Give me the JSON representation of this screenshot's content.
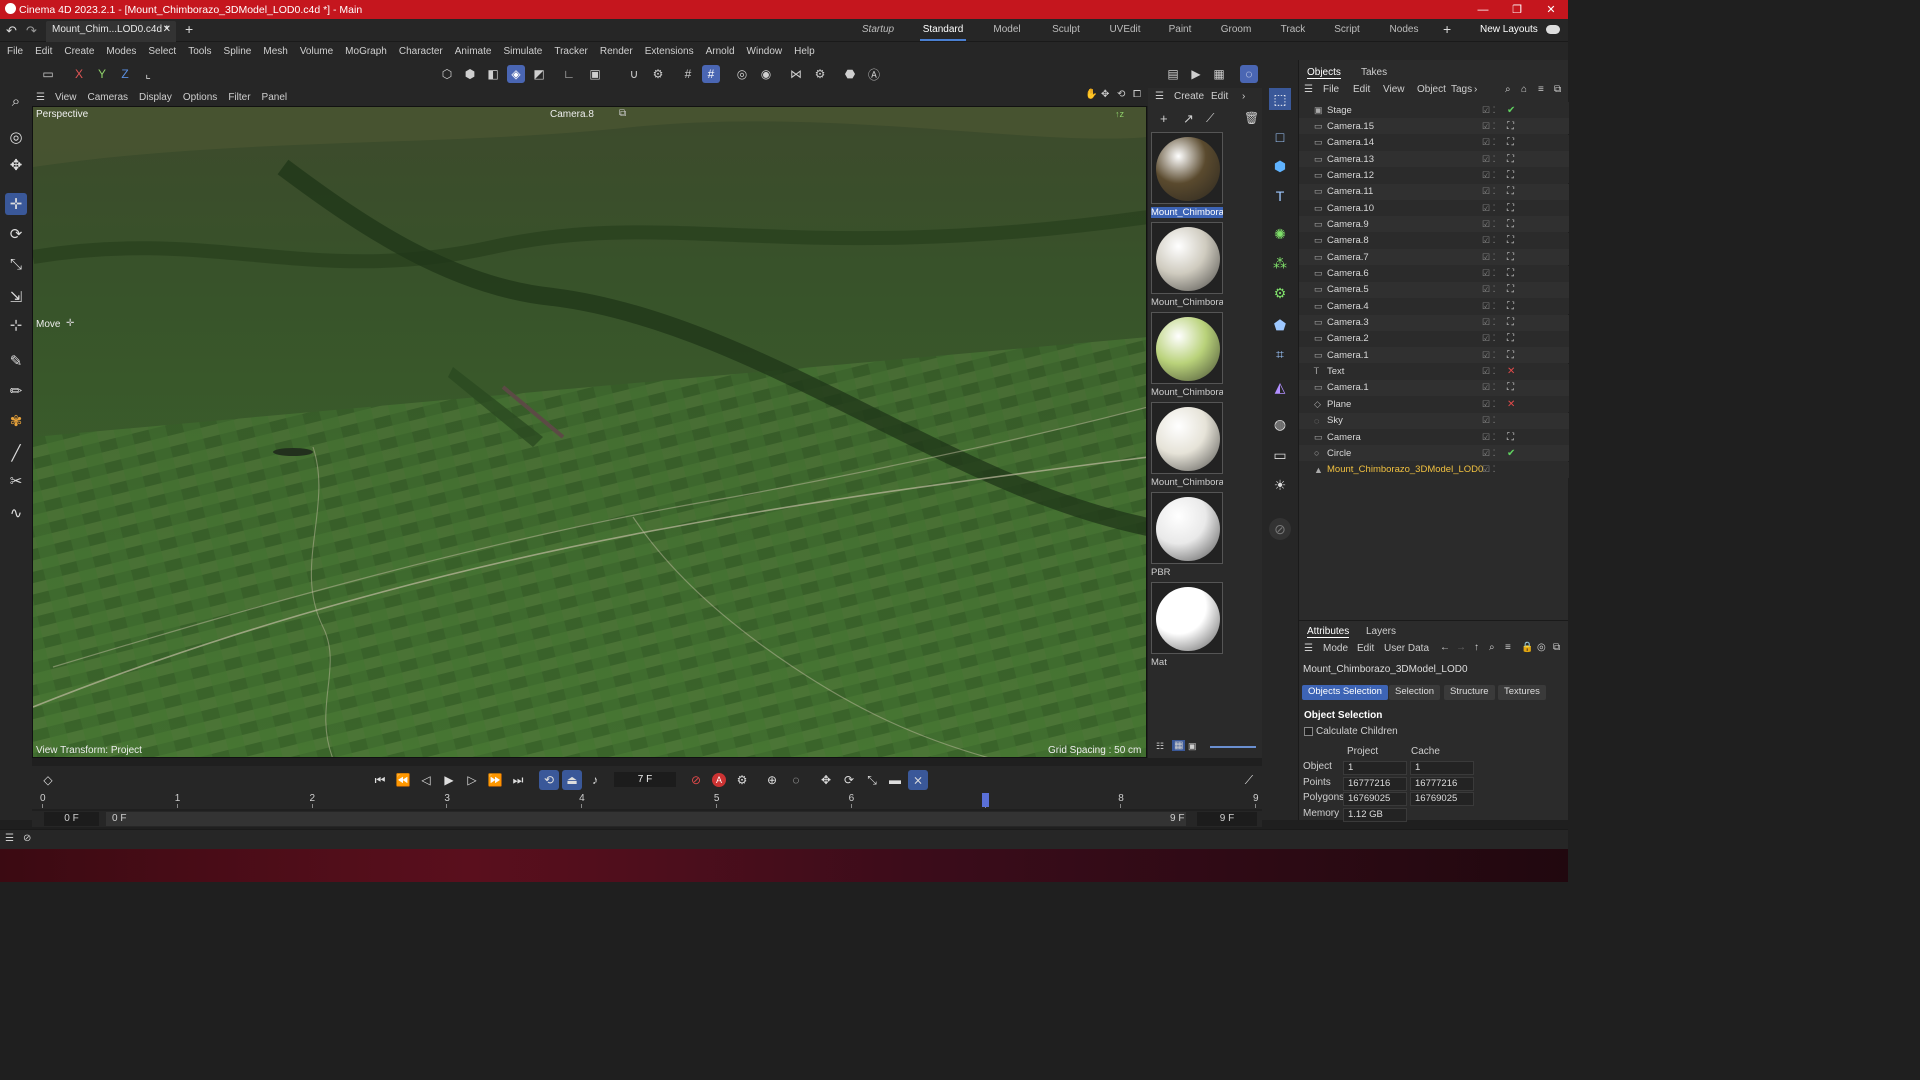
{
  "app": {
    "title": "Cinema 4D 2023.2.1 - [Mount_Chimborazo_3DModel_LOD0.c4d *] - Main",
    "doc_tab": "Mount_Chim...LOD0.c4d *"
  },
  "layouts": [
    "Startup",
    "Standard",
    "Model",
    "Sculpt",
    "UVEdit",
    "Paint",
    "Groom",
    "Track",
    "Script",
    "Nodes"
  ],
  "active_layout": "Standard",
  "new_layouts_label": "New Layouts",
  "menu": [
    "File",
    "Edit",
    "Create",
    "Modes",
    "Select",
    "Tools",
    "Spline",
    "Mesh",
    "Volume",
    "MoGraph",
    "Character",
    "Animate",
    "Simulate",
    "Tracker",
    "Render",
    "Extensions",
    "Arnold",
    "Window",
    "Help"
  ],
  "viewport": {
    "menu": [
      "View",
      "Cameras",
      "Display",
      "Options",
      "Filter",
      "Panel"
    ],
    "label": "Perspective",
    "camera": "Camera.8",
    "tool_label": "Move",
    "view_transform": "View Transform: Project",
    "grid_spacing": "Grid Spacing : 50 cm"
  },
  "material_panel": {
    "menu": [
      "Create",
      "Edit"
    ],
    "materials": [
      {
        "label": "Mount_Chimboraz",
        "color": "#5a4a2e"
      },
      {
        "label": "Mount_Chimboraz",
        "color": "#cfcbbf"
      },
      {
        "label": "Mount_Chimboraz",
        "color": "#b9d27a"
      },
      {
        "label": "Mount_Chimboraz",
        "color": "#e6e3d8"
      },
      {
        "label": "PBR",
        "color": "#e9e9e9"
      },
      {
        "label": "Mat",
        "color": "#ffffff"
      }
    ]
  },
  "objects_panel": {
    "tabs": [
      "Objects",
      "Takes"
    ],
    "menu": [
      "File",
      "Edit",
      "View",
      "Object",
      "Tags"
    ],
    "items": [
      "Stage",
      "Camera.15",
      "Camera.14",
      "Camera.13",
      "Camera.12",
      "Camera.11",
      "Camera.10",
      "Camera.9",
      "Camera.8",
      "Camera.7",
      "Camera.6",
      "Camera.5",
      "Camera.4",
      "Camera.3",
      "Camera.2",
      "Camera.1",
      "Text",
      "Camera.1",
      "Plane",
      "Sky",
      "Camera",
      "Circle",
      "Mount_Chimborazo_3DModel_LOD0"
    ]
  },
  "attributes": {
    "tabs": [
      "Attributes",
      "Layers"
    ],
    "menu": [
      "Mode",
      "Edit",
      "User Data"
    ],
    "object_name": "Mount_Chimborazo_3DModel_LOD0",
    "sub_tabs": [
      "Objects Selection",
      "Selection",
      "Structure",
      "Textures"
    ],
    "section": "Object Selection",
    "calc_children": "Calculate Children",
    "col_project": "Project",
    "col_cache": "Cache",
    "rows": [
      {
        "label": "Object",
        "project": "1",
        "cache": "1"
      },
      {
        "label": "Points",
        "project": "16777216",
        "cache": "16777216"
      },
      {
        "label": "Polygons",
        "project": "16769025",
        "cache": "16769025"
      },
      {
        "label": "Memory",
        "project": "1.12 GB",
        "cache": ""
      }
    ]
  },
  "transport": {
    "current_frame": "7 F",
    "start_frame": "0 F",
    "range_start": "0 F",
    "range_end": "9 F",
    "end_frame": "9 F",
    "ticks": [
      "0",
      "1",
      "2",
      "3",
      "4",
      "5",
      "6",
      "7",
      "8",
      "9"
    ],
    "playhead_frame": 7
  }
}
